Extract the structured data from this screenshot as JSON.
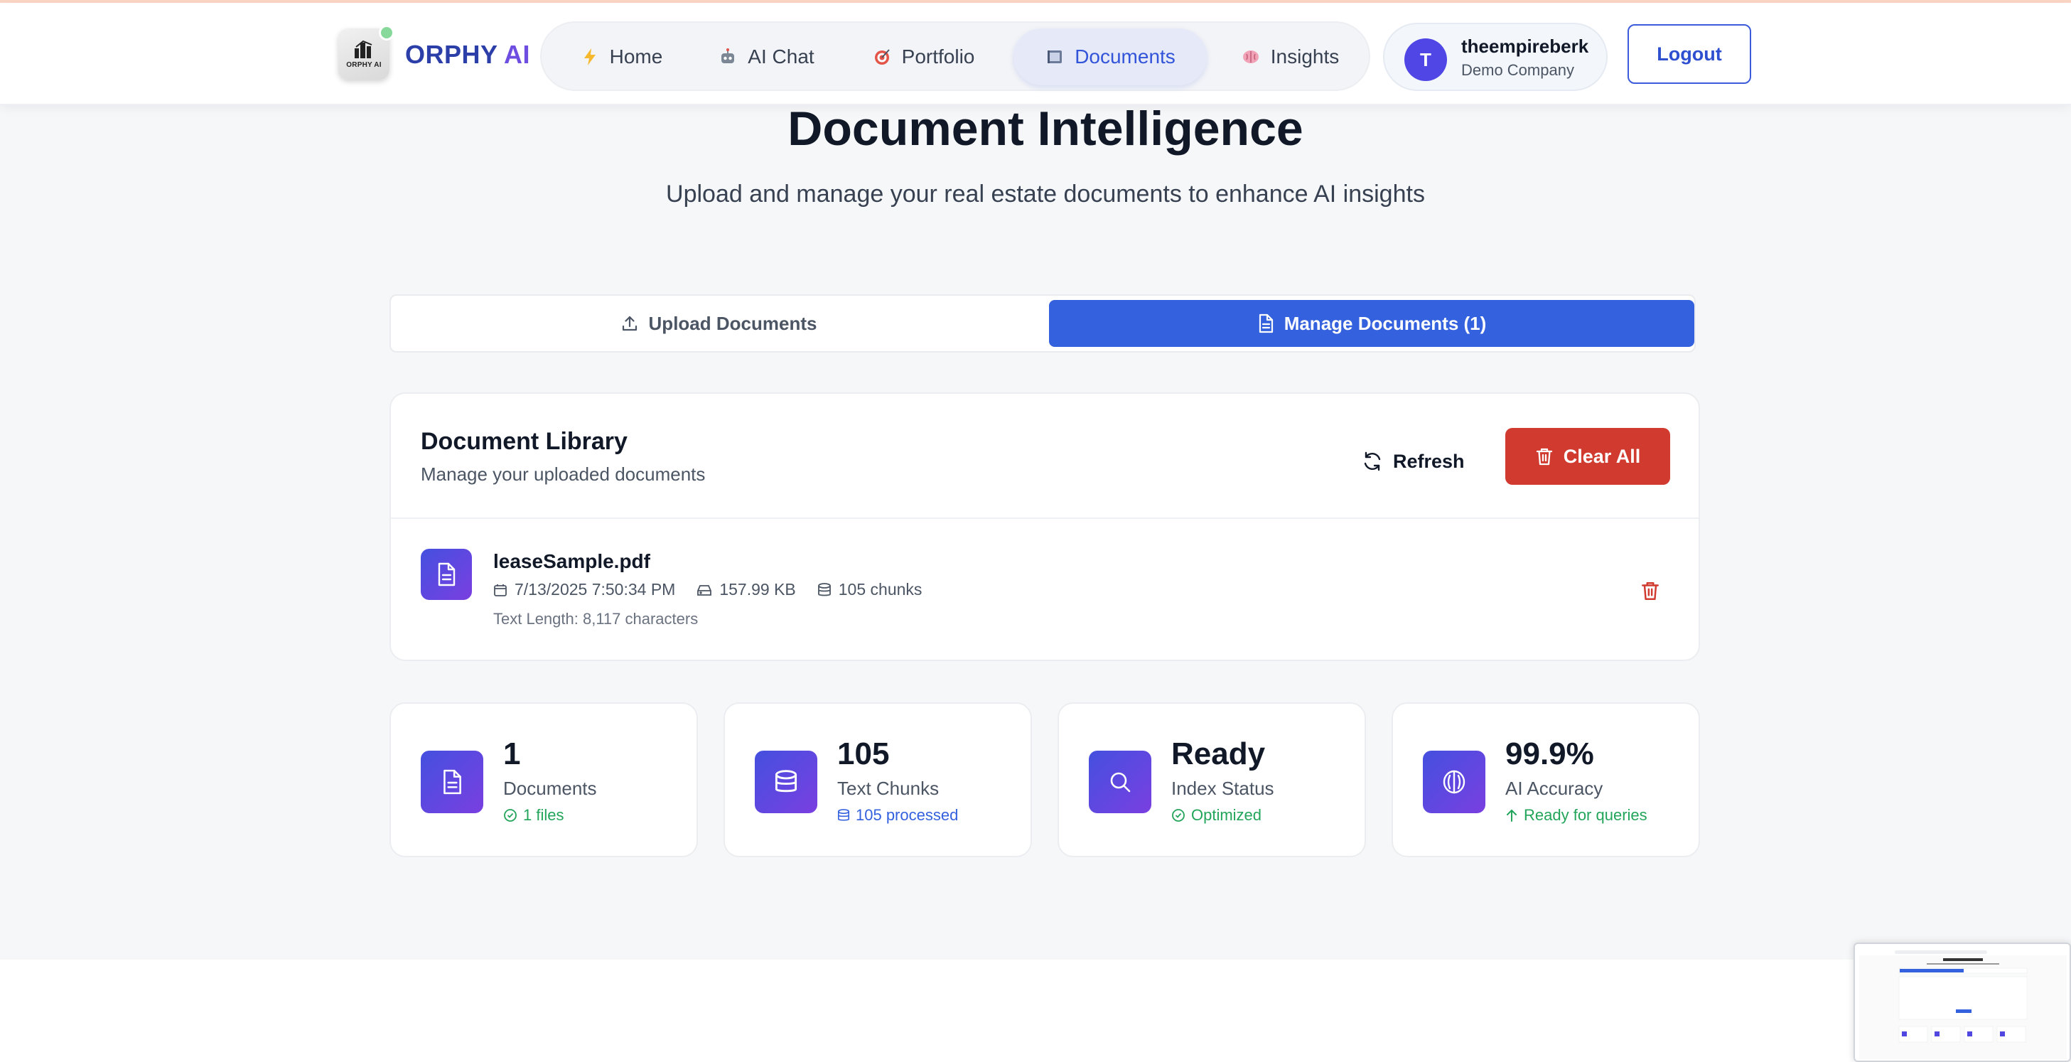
{
  "brand": {
    "name_prefix": "ORPHY",
    "name_suffix": " AI",
    "logo_text": "ORPHY AI"
  },
  "nav": {
    "items": [
      {
        "label": "Home",
        "icon": "lightning-icon"
      },
      {
        "label": "AI Chat",
        "icon": "robot-icon"
      },
      {
        "label": "Portfolio",
        "icon": "target-icon"
      },
      {
        "label": "Documents",
        "icon": "notebook-icon",
        "active": true
      },
      {
        "label": "Insights",
        "icon": "brain-icon"
      }
    ]
  },
  "user": {
    "initial": "T",
    "name": "theempireberk",
    "company": "Demo Company"
  },
  "header": {
    "logout_label": "Logout"
  },
  "page": {
    "title": "Document Intelligence",
    "subtitle": "Upload and manage your real estate documents to enhance AI insights"
  },
  "tabs": {
    "upload_label": "Upload Documents",
    "manage_label": "Manage Documents (1)"
  },
  "library": {
    "title": "Document Library",
    "subtitle": "Manage your uploaded documents",
    "refresh_label": "Refresh",
    "clear_label": "Clear All",
    "documents": [
      {
        "name": "leaseSample.pdf",
        "date": "7/13/2025 7:50:34 PM",
        "size": "157.99 KB",
        "chunks": "105 chunks",
        "text_length": "Text Length: 8,117 characters"
      }
    ]
  },
  "stats": [
    {
      "value": "1",
      "label": "Documents",
      "note": "1 files",
      "note_color": "#22a55a"
    },
    {
      "value": "105",
      "label": "Text Chunks",
      "note": "105 processed",
      "note_color": "#3461de"
    },
    {
      "value": "Ready",
      "label": "Index Status",
      "note": "Optimized",
      "note_color": "#22a55a"
    },
    {
      "value": "99.9%",
      "label": "AI Accuracy",
      "note": "Ready for queries",
      "note_color": "#22a55a"
    }
  ],
  "colors": {
    "primary": "#3461de",
    "danger": "#d03a2f",
    "success": "#22a55a",
    "accent_gradient": [
      "#4450df",
      "#7a3fe0"
    ]
  }
}
